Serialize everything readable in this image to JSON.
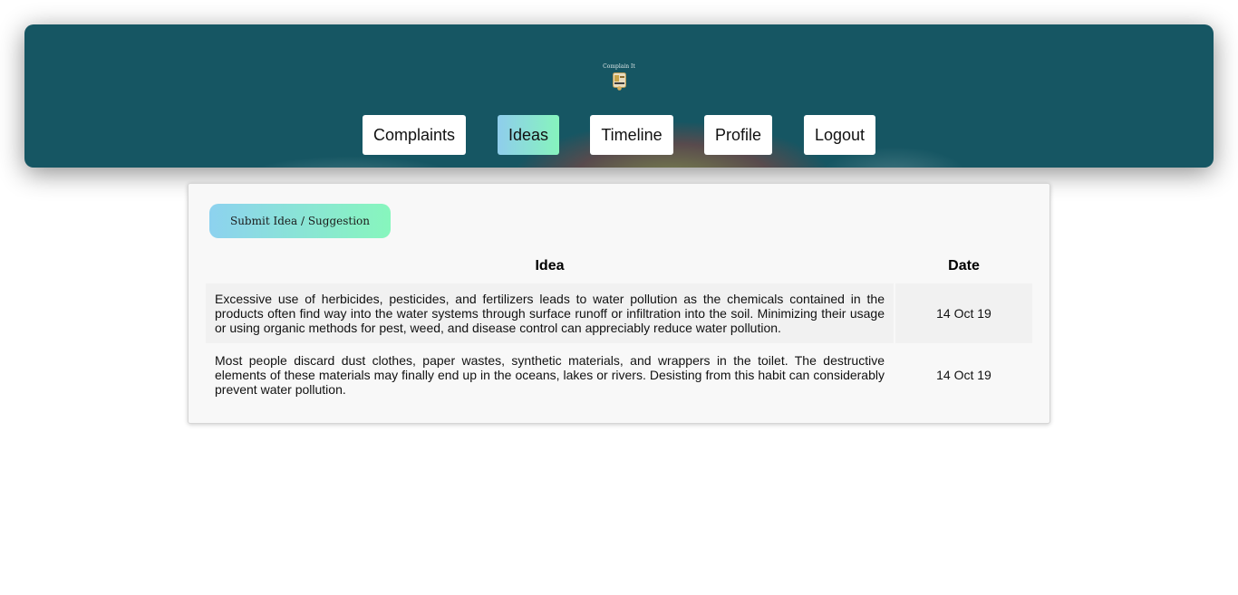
{
  "header": {
    "logo_text": "Complain It",
    "nav": [
      {
        "label": "Complaints",
        "active": false
      },
      {
        "label": "Ideas",
        "active": true
      },
      {
        "label": "Timeline",
        "active": false
      },
      {
        "label": "Profile",
        "active": false
      },
      {
        "label": "Logout",
        "active": false
      }
    ],
    "colors": {
      "background": "#165663",
      "active_gradient_start": "#8fcdec",
      "active_gradient_end": "#86f4bd"
    }
  },
  "main": {
    "submit_label": "Submit Idea / Suggestion",
    "table": {
      "columns": [
        "Idea",
        "Date"
      ],
      "rows": [
        {
          "idea": "Excessive use of herbicides, pesticides, and fertilizers leads to water pollution as the chemicals contained in the products often find way into the water systems through surface runoff or infiltration into the soil. Minimizing their usage or using organic methods for pest, weed, and disease control can appreciably reduce water pollution.",
          "date": "14 Oct 19"
        },
        {
          "idea": "Most people discard dust clothes, paper wastes, synthetic materials, and wrappers in the toilet. The destructive elements of these materials may finally end up in the oceans, lakes or rivers. Desisting from this habit can considerably prevent water pollution.",
          "date": "14 Oct 19"
        }
      ]
    }
  }
}
